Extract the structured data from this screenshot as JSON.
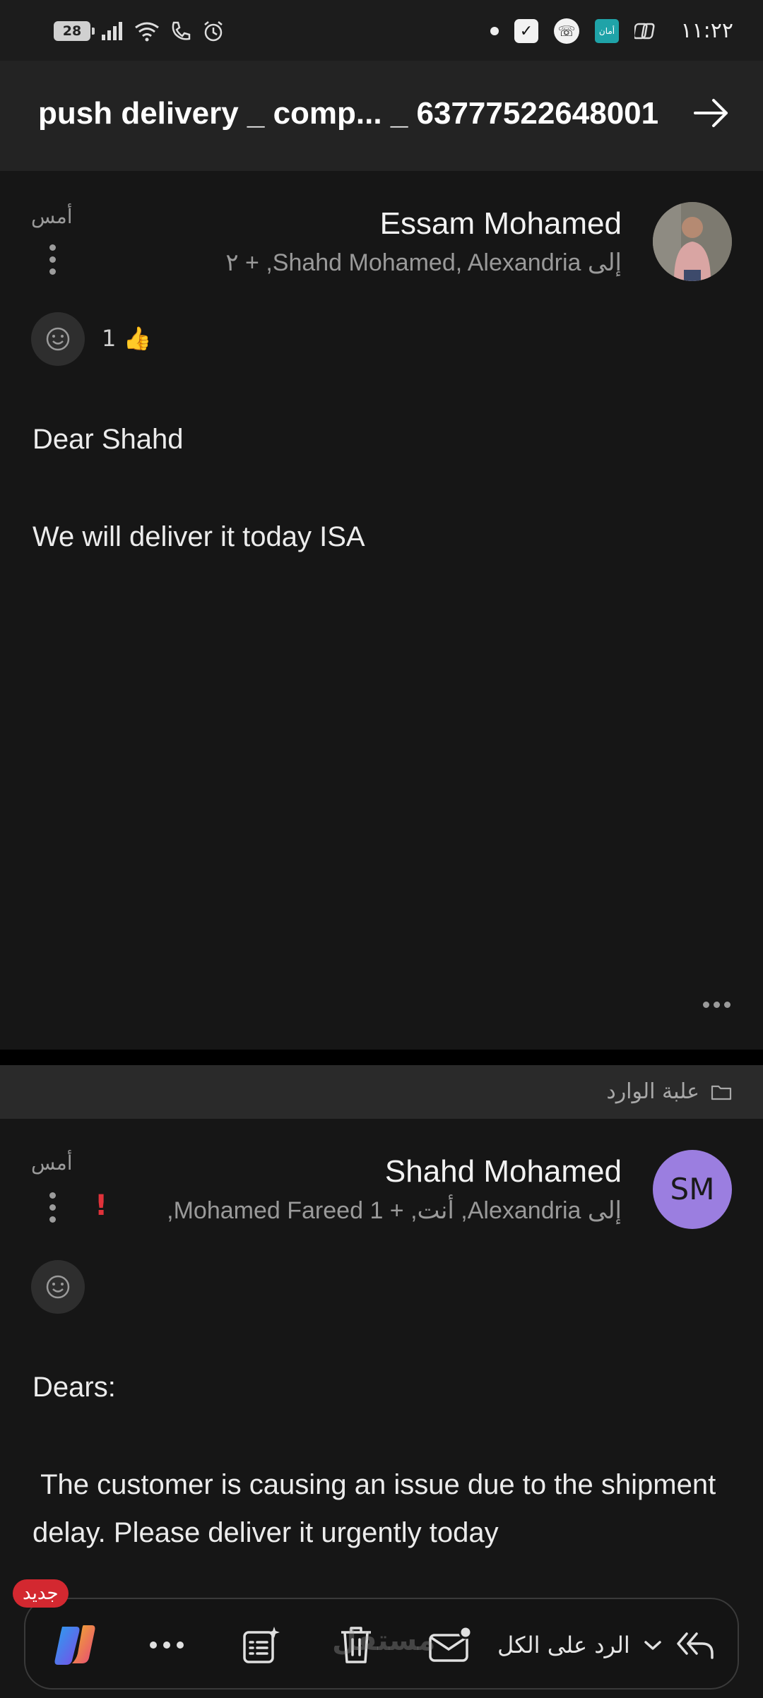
{
  "status_bar": {
    "battery": "28",
    "time": "١١:٢٢",
    "teal_app_label": "أمان"
  },
  "header": {
    "title": "push delivery _ comp... _ 63777522648001"
  },
  "messages": [
    {
      "sender": "Essam Mohamed",
      "recipients": "إلى Shahd Mohamed, Alexandria, + ٢",
      "date": "أمس",
      "reaction_count": "1",
      "reaction_emoji": "👍",
      "body": [
        "Dear Shahd",
        "We will deliver it today ISA"
      ]
    },
    {
      "sender": "Shahd Mohamed",
      "initials": "SM",
      "recipients": "إلى Alexandria, أنت, + 1 Mohamed Fareed,",
      "date": "أمس",
      "importance": "!",
      "body": [
        "Dears:",
        " The customer is causing an issue due to the shipment delay. Please deliver it urgently today"
      ]
    }
  ],
  "folder": {
    "label": "علبة الوارد"
  },
  "toolbar": {
    "new_badge": "جديد",
    "reply_all_label": "الرد على الكل"
  },
  "watermark": "مستقل",
  "colors": {
    "background": "#161616",
    "avatar_sm": "#9b7ee0",
    "importance": "#e0323a",
    "badge": "#d32830"
  }
}
